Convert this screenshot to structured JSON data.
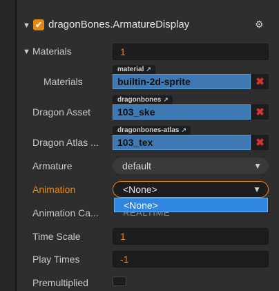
{
  "component": {
    "title": "dragonBones.ArmatureDisplay",
    "enabled": true,
    "collapse_glyph": "▼",
    "check_glyph": "✔",
    "gear_glyph": "⚙"
  },
  "materials": {
    "label": "Materials",
    "count": "1",
    "item_label": "Materials",
    "item_tag": "material",
    "item_value": "builtin-2d-sprite"
  },
  "dragon_asset": {
    "label": "Dragon Asset",
    "tag": "dragonbones",
    "value": "103_ske"
  },
  "dragon_atlas": {
    "label": "Dragon Atlas ...",
    "tag": "dragonbones-atlas",
    "value": "103_tex"
  },
  "armature": {
    "label": "Armature",
    "value": "default"
  },
  "animation": {
    "label": "Animation",
    "value": "<None>",
    "dropdown_options": [
      "<None>"
    ]
  },
  "animation_cache": {
    "label": "Animation Ca...",
    "value": "REALTIME"
  },
  "time_scale": {
    "label": "Time Scale",
    "value": "1"
  },
  "play_times": {
    "label": "Play Times",
    "value": "-1"
  },
  "premultiplied": {
    "label": "Premultiplied"
  },
  "icons": {
    "remove": "✖",
    "open_external": "↗",
    "dropdown_arrow": "▼"
  },
  "colors": {
    "accent": "#e8870f",
    "asset_fill": "#3e79b3",
    "dropdown_highlight": "#2f86e0",
    "remove": "#d8322b"
  }
}
